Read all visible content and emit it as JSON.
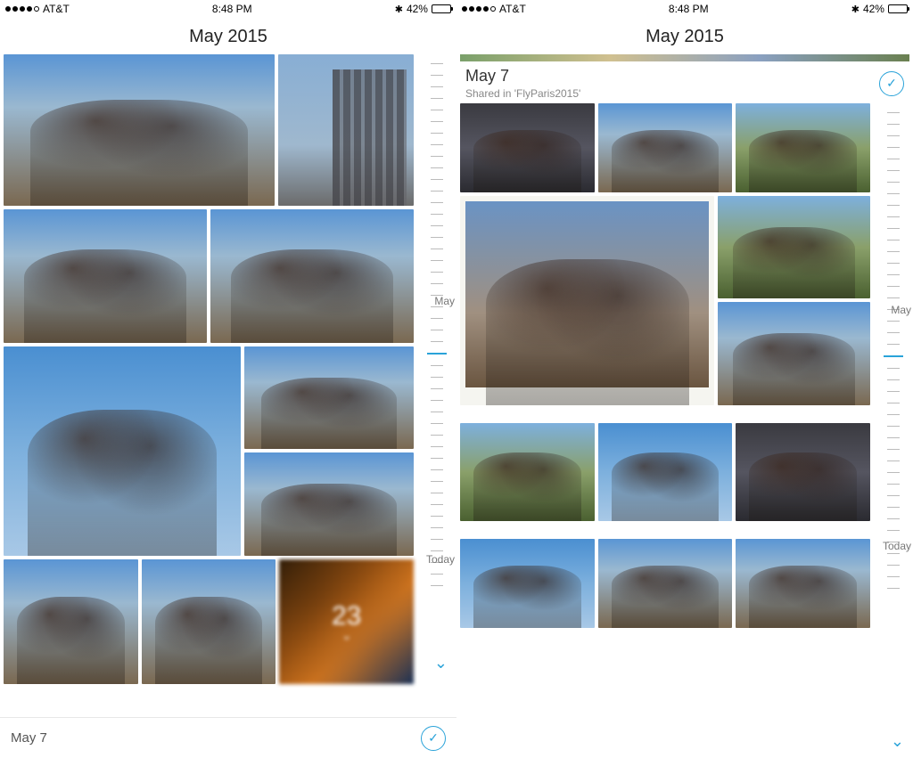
{
  "status": {
    "carrier": "AT&T",
    "time": "8:48 PM",
    "battery_pct": "42%",
    "battery_fill": 42
  },
  "title": "May 2015",
  "timeline": {
    "month_label": "May",
    "today_label": "Today"
  },
  "left": {
    "more_count": "23",
    "footer_date": "May 7"
  },
  "right": {
    "section_date": "May 7",
    "shared_in": "Shared in 'FlyParis2015'"
  },
  "icons": {
    "bluetooth": "✱",
    "check": "✓",
    "chevron_down": "⌄"
  }
}
